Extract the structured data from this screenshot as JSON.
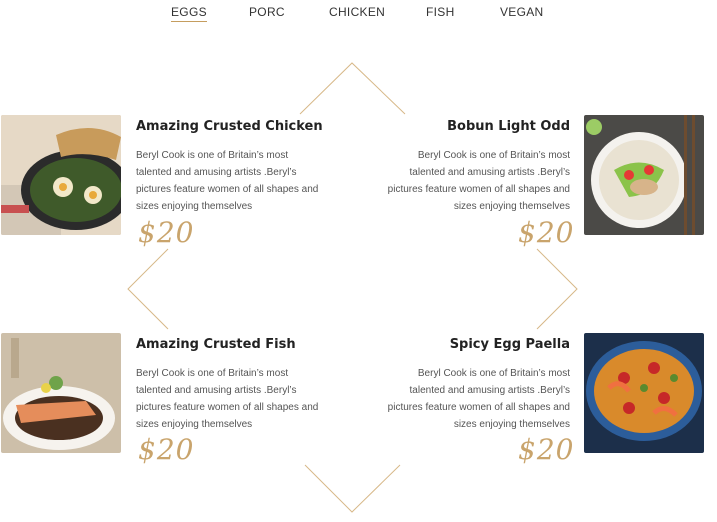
{
  "tabs": [
    {
      "label": "EGGS",
      "active": true
    },
    {
      "label": "PORC",
      "active": false
    },
    {
      "label": "CHICKEN",
      "active": false
    },
    {
      "label": "FISH",
      "active": false
    },
    {
      "label": "VEGAN",
      "active": false
    }
  ],
  "accent_color": "#c59d5f",
  "dishes": [
    {
      "title": "Amazing Crusted Chicken",
      "description": "Beryl Cook is one of Britain’s most talented and amusing artists .Beryl’s pictures feature women of all shapes and sizes enjoying themselves",
      "price": "$20"
    },
    {
      "title": "Bobun Light Odd",
      "description": "Beryl Cook is one of Britain’s most talented and amusing artists .Beryl’s pictures feature women of all shapes and sizes enjoying themselves",
      "price": "$20"
    },
    {
      "title": "Amazing Crusted Fish",
      "description": "Beryl Cook is one of Britain’s most talented and amusing artists .Beryl’s pictures feature women of all shapes and sizes enjoying themselves",
      "price": "$20"
    },
    {
      "title": "Spicy Egg Paella",
      "description": "Beryl Cook is one of Britain’s most talented and amusing artists .Beryl’s pictures feature women of all shapes and sizes enjoying themselves",
      "price": "$20"
    }
  ]
}
